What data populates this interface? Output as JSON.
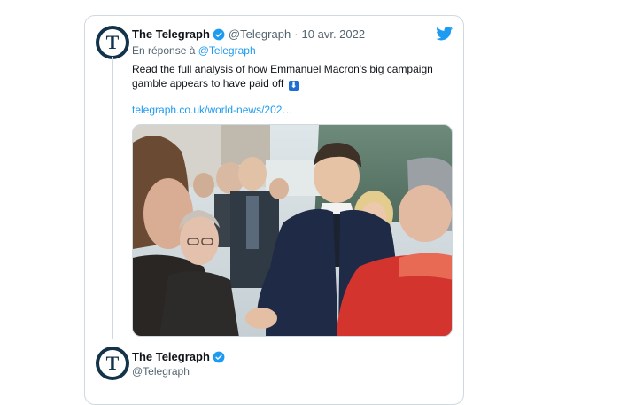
{
  "tweet": {
    "author_name": "The Telegraph",
    "handle": "@Telegraph",
    "separator": "·",
    "date": "10 avr. 2022",
    "reply_prefix": "En réponse à",
    "reply_to": "@Telegraph",
    "text": "Read the full analysis of how Emmanuel Macron's big campaign gamble appears to have paid off",
    "emoji": "⬇",
    "link": "telegraph.co.uk/world-news/202…",
    "avatar_letter": "T"
  },
  "next_tweet": {
    "author_name": "The Telegraph",
    "handle": "@Telegraph",
    "avatar_letter": "T"
  },
  "colors": {
    "accent": "#1d9bf0",
    "text": "#0f1419",
    "muted": "#536471",
    "border": "#cfd9de",
    "brand_navy": "#12334a"
  },
  "icons": {
    "brand": "twitter-bird-icon",
    "verified": "verified-badge-icon"
  }
}
